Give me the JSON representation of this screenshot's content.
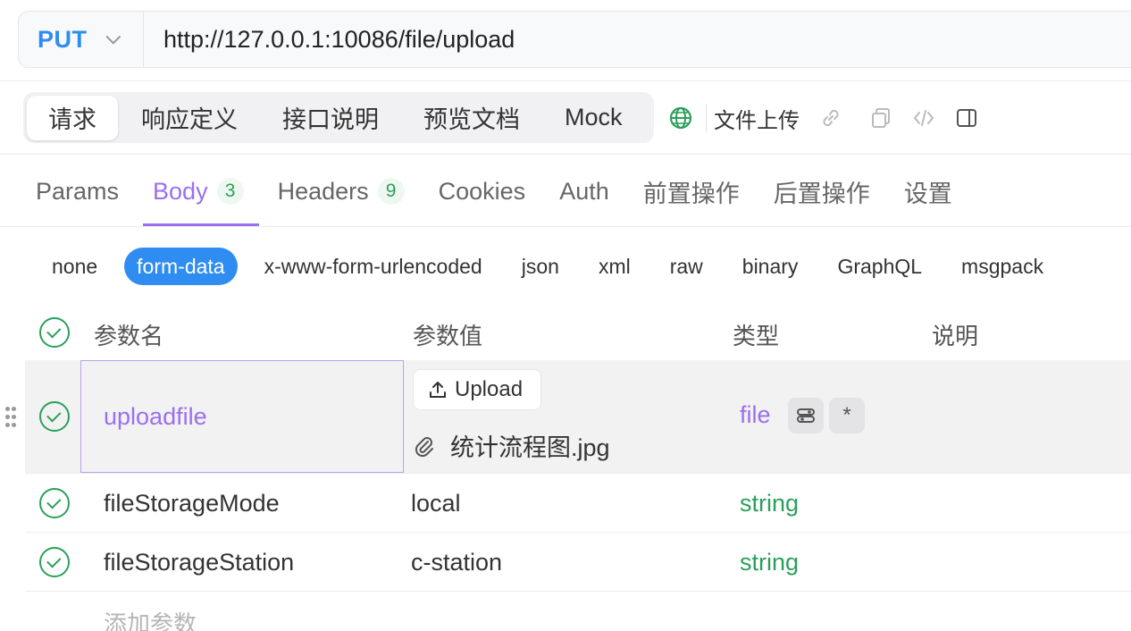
{
  "request": {
    "method": "PUT",
    "url": "http://127.0.0.1:10086/file/upload"
  },
  "mode_tabs": [
    {
      "label": "请求",
      "active": true
    },
    {
      "label": "响应定义",
      "active": false
    },
    {
      "label": "接口说明",
      "active": false
    },
    {
      "label": "预览文档",
      "active": false
    },
    {
      "label": "Mock",
      "active": false
    }
  ],
  "toolbar": {
    "doc_name": "文件上传",
    "icons": [
      "globe-icon",
      "link-icon",
      "copy-icon",
      "code-icon",
      "panel-icon"
    ]
  },
  "tabs": [
    {
      "label": "Params",
      "count": null,
      "active": false
    },
    {
      "label": "Body",
      "count": "3",
      "active": true
    },
    {
      "label": "Headers",
      "count": "9",
      "active": false
    },
    {
      "label": "Cookies",
      "count": null,
      "active": false
    },
    {
      "label": "Auth",
      "count": null,
      "active": false
    },
    {
      "label": "前置操作",
      "count": null,
      "active": false
    },
    {
      "label": "后置操作",
      "count": null,
      "active": false
    },
    {
      "label": "设置",
      "count": null,
      "active": false
    }
  ],
  "body_types": [
    {
      "label": "none",
      "active": false
    },
    {
      "label": "form-data",
      "active": true
    },
    {
      "label": "x-www-form-urlencoded",
      "active": false
    },
    {
      "label": "json",
      "active": false
    },
    {
      "label": "xml",
      "active": false
    },
    {
      "label": "raw",
      "active": false
    },
    {
      "label": "binary",
      "active": false
    },
    {
      "label": "GraphQL",
      "active": false
    },
    {
      "label": "msgpack",
      "active": false
    }
  ],
  "table": {
    "headers": {
      "name": "参数名",
      "value": "参数值",
      "type": "类型",
      "desc": "说明"
    },
    "rows": [
      {
        "name": "uploadfile",
        "upload_label": "Upload",
        "file": "统计流程图.jpg",
        "type": "file",
        "chip_required": "*"
      },
      {
        "name": "fileStorageMode",
        "value": "local",
        "type": "string"
      },
      {
        "name": "fileStorageStation",
        "value": "c-station",
        "type": "string"
      }
    ],
    "add_placeholder": "添加参数"
  },
  "colors": {
    "method": "#2f8cf0",
    "accent": "#9b6ff0",
    "success": "#2aa05a",
    "primary": "#2f8cf0"
  }
}
